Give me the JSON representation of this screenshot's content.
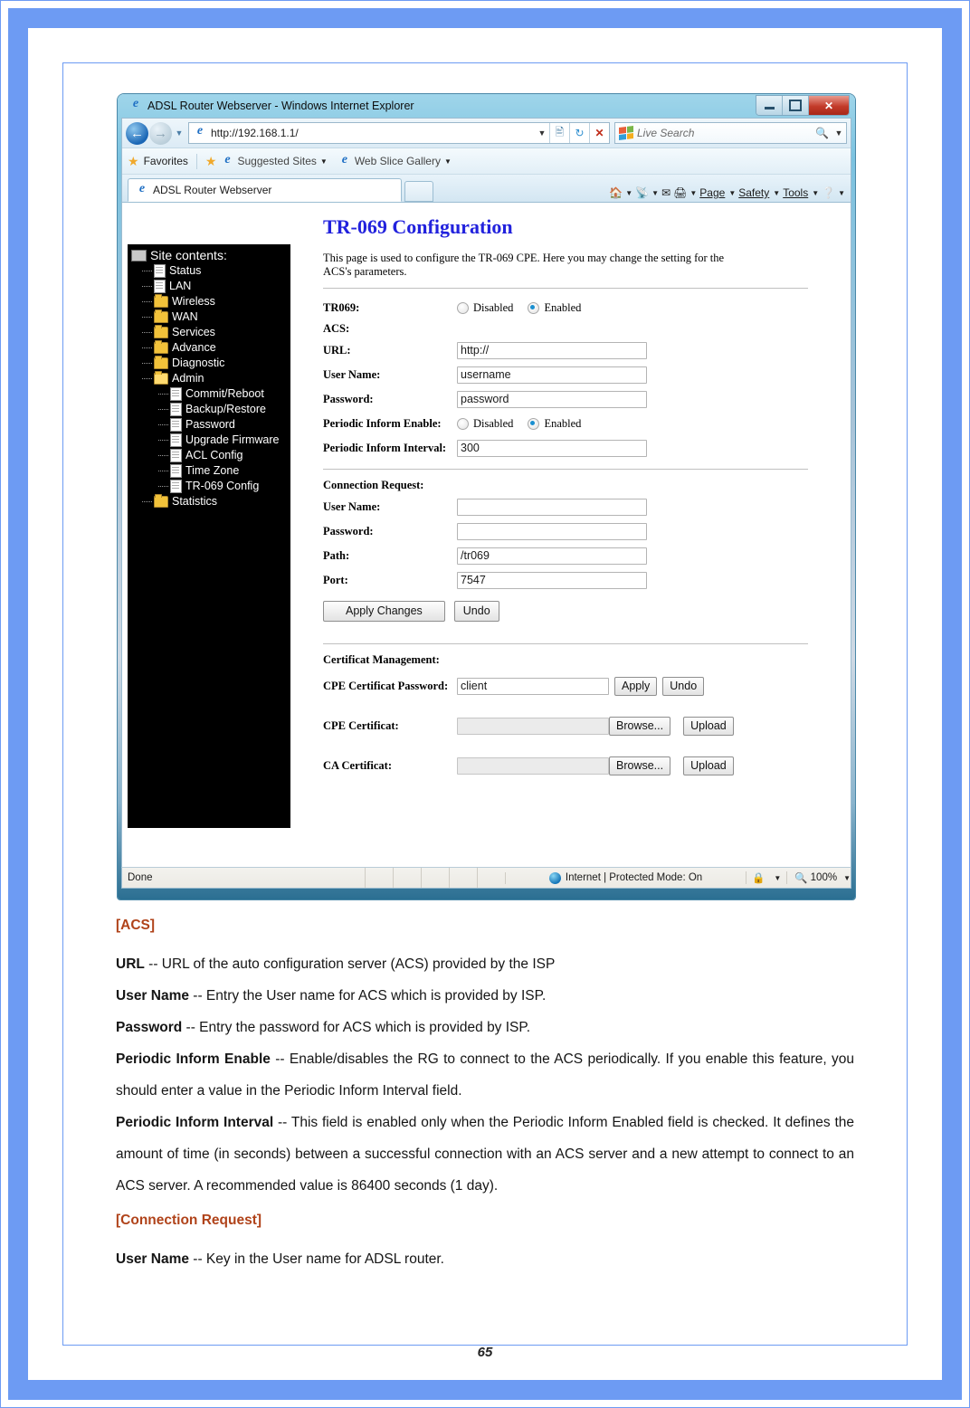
{
  "browser": {
    "title": "ADSL Router Webserver - Windows Internet Explorer",
    "url": "http://192.168.1.1/",
    "search_placeholder": "Live Search",
    "favorites_label": "Favorites",
    "suggested_sites_label": "Suggested Sites",
    "web_slice_label": "Web Slice Gallery",
    "tab_label": "ADSL Router Webserver",
    "command_bar": [
      "Page",
      "Safety",
      "Tools"
    ],
    "window_buttons": {
      "minimize": "minimize-icon",
      "maximize": "maximize-icon",
      "close": "✕"
    },
    "status": {
      "message": "Done",
      "zone": "Internet | Protected Mode: On",
      "zoom": "100%"
    }
  },
  "sidebar": {
    "root": "Site contents:",
    "items": [
      {
        "label": "Status",
        "icon": "page-icon",
        "level": 1
      },
      {
        "label": "LAN",
        "icon": "page-icon",
        "level": 1
      },
      {
        "label": "Wireless",
        "icon": "folder-icon",
        "level": 1
      },
      {
        "label": "WAN",
        "icon": "folder-icon",
        "level": 1
      },
      {
        "label": "Services",
        "icon": "folder-icon",
        "level": 1
      },
      {
        "label": "Advance",
        "icon": "folder-icon",
        "level": 1
      },
      {
        "label": "Diagnostic",
        "icon": "folder-icon",
        "level": 1
      },
      {
        "label": "Admin",
        "icon": "folder-open-icon",
        "level": 1
      },
      {
        "label": "Commit/Reboot",
        "icon": "page-icon",
        "level": 2
      },
      {
        "label": "Backup/Restore",
        "icon": "page-icon",
        "level": 2
      },
      {
        "label": "Password",
        "icon": "page-icon",
        "level": 2
      },
      {
        "label": "Upgrade Firmware",
        "icon": "page-icon",
        "level": 2
      },
      {
        "label": "ACL Config",
        "icon": "page-icon",
        "level": 2
      },
      {
        "label": "Time Zone",
        "icon": "page-icon",
        "level": 2
      },
      {
        "label": "TR-069 Config",
        "icon": "page-icon",
        "level": 2
      },
      {
        "label": "Statistics",
        "icon": "folder-icon",
        "level": 1
      }
    ]
  },
  "page": {
    "title": "TR-069 Configuration",
    "description": "This page is used to configure the TR-069 CPE. Here you may change the setting for the ACS's parameters.",
    "tr069": {
      "label": "TR069:",
      "disabled_label": "Disabled",
      "enabled_label": "Enabled",
      "selected": "Enabled"
    },
    "acs": {
      "heading": "ACS:",
      "url_label": "URL:",
      "url_value": "http://",
      "username_label": "User Name:",
      "username_value": "username",
      "password_label": "Password:",
      "password_value": "password",
      "periodic_inform_enable_label": "Periodic Inform Enable:",
      "periodic_disabled_label": "Disabled",
      "periodic_enabled_label": "Enabled",
      "periodic_selected": "Enabled",
      "periodic_interval_label": "Periodic Inform Interval:",
      "periodic_interval_value": "300"
    },
    "connection_request": {
      "heading": "Connection Request:",
      "username_label": "User Name:",
      "username_value": "",
      "password_label": "Password:",
      "password_value": "",
      "path_label": "Path:",
      "path_value": "/tr069",
      "port_label": "Port:",
      "port_value": "7547"
    },
    "actions": {
      "apply_changes": "Apply Changes",
      "undo": "Undo"
    },
    "certificate": {
      "heading": "Certificat Management:",
      "cpe_password_label": "CPE Certificat Password:",
      "cpe_password_value": "client",
      "apply_label": "Apply",
      "undo_label": "Undo",
      "cpe_cert_label": "CPE Certificat:",
      "cpe_cert_value": "",
      "ca_cert_label": "CA Certificat:",
      "ca_cert_value": "",
      "browse_label": "Browse...",
      "upload_label": "Upload"
    }
  },
  "document": {
    "acs_heading": "[ACS]",
    "entries": [
      {
        "term": "URL",
        "text": " -- URL of the auto configuration server (ACS) provided by the ISP"
      },
      {
        "term": "User Name",
        "text": " -- Entry the User name for ACS which is provided by ISP."
      },
      {
        "term": "Password",
        "text": " -- Entry the password for ACS which is provided by ISP."
      },
      {
        "term": "Periodic Inform Enable",
        "text": " -- Enable/disables the RG to connect to the ACS periodically. If you enable this feature, you should enter a value in the Periodic Inform Interval field."
      },
      {
        "term": "Periodic Inform Interval",
        "text": " -- This field is enabled only when the Periodic Inform Enabled field is checked. It defines the amount of time (in seconds) between a successful connection with an ACS server and a new attempt to connect to an ACS server. A recommended value is 86400 seconds (1 day)."
      }
    ],
    "connection_request_heading": "[Connection Request]",
    "connection_entries": [
      {
        "term": "User Name",
        "text": " -- Key in the User name for ADSL router."
      }
    ],
    "page_number": "65"
  },
  "colors": {
    "accent_border": "#6d9bf3",
    "heading_blue": "#2222dd",
    "doc_heading": "#b0431a",
    "sidebar_bg": "#000000"
  }
}
